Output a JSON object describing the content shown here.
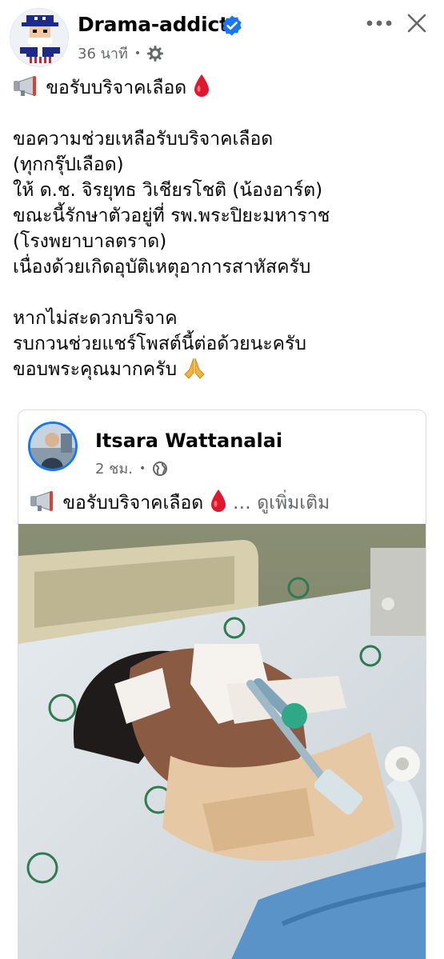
{
  "post": {
    "author": "Drama-addict",
    "time": "36 นาที",
    "dot": "•",
    "body": {
      "title": "ขอรับบริจาคเลือด",
      "lines": [
        "ขอความช่วยเหลือรับบริจาคเลือด",
        "(ทุกกรุ๊ปเลือด)",
        "ให้ ด.ช. จิรยุทธ วิเชียรโชติ (น้องอาร์ต)",
        "ขณะนี้รักษาตัวอยู่ที่ รพ.พระปิยะมหาราช",
        "(โรงพยาบาลตราด)",
        "เนื่องด้วยเกิดอุบัติเหตุอาการสาหัสครับ"
      ],
      "closing": [
        "หากไม่สะดวกบริจาค",
        "รบกวนช่วยแชร์โพสต์นี้ต่อด้วยนะครับ"
      ],
      "thanks": "ขอบพระคุณมากครับ"
    }
  },
  "shared": {
    "author": "Itsara Wattanalai",
    "time": "2 ชม.",
    "dot": "•",
    "text": "ขอรับบริจาคเลือด",
    "ellipsis": "…",
    "see_more": "ดูเพิ่มเติม"
  },
  "icons": {
    "header_more": "more-dots-icon",
    "header_close": "close-icon",
    "verified": "verified-badge-icon",
    "audience_post": "gear-icon",
    "audience_shared": "globe-icon",
    "megaphone": "megaphone-icon",
    "blood_drop": "blood-drop-icon",
    "pray": "folded-hands-icon"
  },
  "colors": {
    "verified_blue": "#1877f2",
    "meta_gray": "#65676b",
    "blood_red": "#e0182d"
  }
}
